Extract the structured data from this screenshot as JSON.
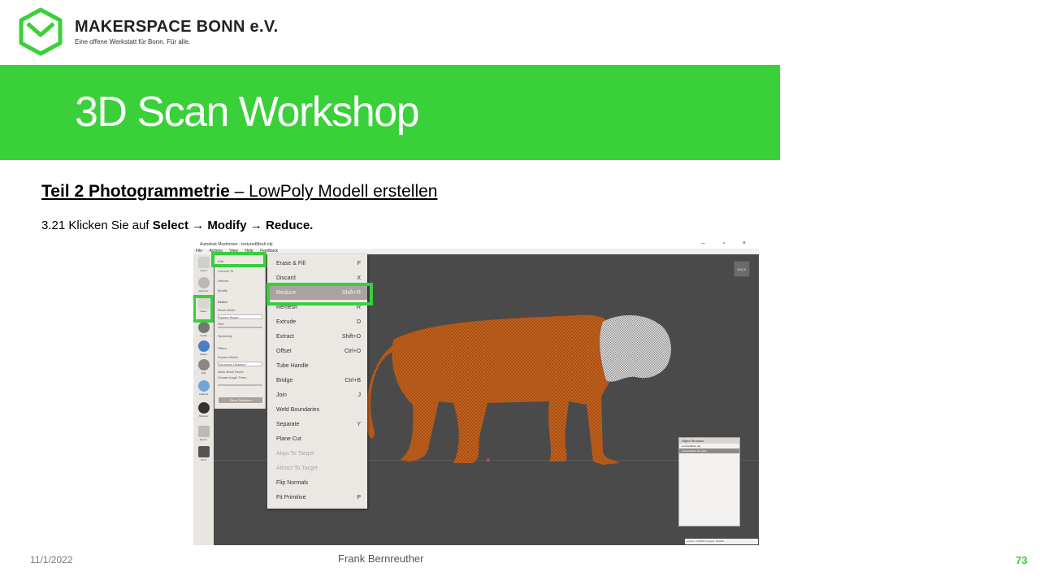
{
  "header": {
    "brand_name": "MAKERSPACE BONN e.V.",
    "brand_tagline": "Eine offene Werkstatt für Bonn. Für alle.",
    "banner_title": "3D Scan Workshop"
  },
  "content": {
    "subtitle_bold": "Teil 2  Photogrammetrie ",
    "subtitle_rest": " – LowPoly Modell erstellen",
    "step_prefix": "3.21 Klicken Sie auf ",
    "step_select": "Select",
    "step_arrow": "→",
    "step_modify": "Modify",
    "step_reduce": "Reduce."
  },
  "footer": {
    "date": "11/1/2022",
    "author": "Frank Bernreuther",
    "page": "73"
  },
  "colors": {
    "accent": "#3ad03a",
    "highlight_box": "#37cf3d",
    "mesh_orange": "#c2611d",
    "mesh_head": "#d9d9d9"
  },
  "app": {
    "window_title": "Autodesk Meshmixer - texturedMesh.obj",
    "window_controls": "–  ▫  ×",
    "menu": [
      "File",
      "Actions",
      "View",
      "Help",
      "Feedback"
    ],
    "toolbar": [
      {
        "label": "Import",
        "icon": "plus-icon"
      },
      {
        "label": "Meshmix",
        "icon": "sphere-icon"
      },
      {
        "label": "Select",
        "icon": "select-arrow-icon"
      },
      {
        "label": "Sculpt",
        "icon": "brush-icon"
      },
      {
        "label": "Stamp",
        "icon": "stamp-icon"
      },
      {
        "label": "Edit",
        "icon": "edit-icon"
      },
      {
        "label": "Analysis",
        "icon": "analysis-icon"
      },
      {
        "label": "Shaders",
        "icon": "shaders-icon"
      },
      {
        "label": "Export",
        "icon": "export-icon"
      },
      {
        "label": "Print",
        "icon": "print-icon"
      }
    ],
    "panel": {
      "edit": "Edit",
      "convert": "Convert To",
      "deform": "Deform",
      "modify": "Modify",
      "select": "Select",
      "brush_mode": "Brush Mode",
      "brush_value": "Sphere Brush",
      "size": "Size",
      "size_value": "35",
      "symmetry": "Symmetry",
      "filters": "Filters",
      "expand_mode": "Expand Mode",
      "expand_value": "Geodesic Distance",
      "allow_back": "Allow Back Faces",
      "crease_angle": "Crease Angle Thres",
      "clear_button": "Clear Selection"
    },
    "modify_menu": [
      {
        "label": "Erase & Fill",
        "shortcut": "F",
        "state": "normal"
      },
      {
        "label": "Discard",
        "shortcut": "X",
        "state": "normal"
      },
      {
        "label": "Reduce",
        "shortcut": "Shift+R",
        "state": "highlighted"
      },
      {
        "label": "Remesh",
        "shortcut": "R",
        "state": "normal"
      },
      {
        "label": "Extrude",
        "shortcut": "D",
        "state": "normal"
      },
      {
        "label": "Extract",
        "shortcut": "Shift+D",
        "state": "normal"
      },
      {
        "label": "Offset",
        "shortcut": "Ctrl+D",
        "state": "normal"
      },
      {
        "label": "Tube Handle",
        "shortcut": "",
        "state": "normal"
      },
      {
        "label": "Bridge",
        "shortcut": "Ctrl+B",
        "state": "normal"
      },
      {
        "label": "Join",
        "shortcut": "J",
        "state": "normal"
      },
      {
        "label": "Weld Boundaries",
        "shortcut": "",
        "state": "normal"
      },
      {
        "label": "Separate",
        "shortcut": "Y",
        "state": "normal"
      },
      {
        "label": "Plane Cut",
        "shortcut": "",
        "state": "normal"
      },
      {
        "label": "Align To Target",
        "shortcut": "",
        "state": "disabled"
      },
      {
        "label": "Attract To Target",
        "shortcut": "",
        "state": "disabled"
      },
      {
        "label": "Flip Normals",
        "shortcut": "",
        "state": "normal"
      },
      {
        "label": "Fit Primitive",
        "shortcut": "P",
        "state": "normal"
      }
    ],
    "viewcube": "BACK",
    "object_browser": {
      "title": "Object Browser",
      "items": [
        "texturedMesh.obj",
        "texturedMesh.obj (part)"
      ]
    },
    "status": "vertices: 120000 triangles: 240000"
  }
}
